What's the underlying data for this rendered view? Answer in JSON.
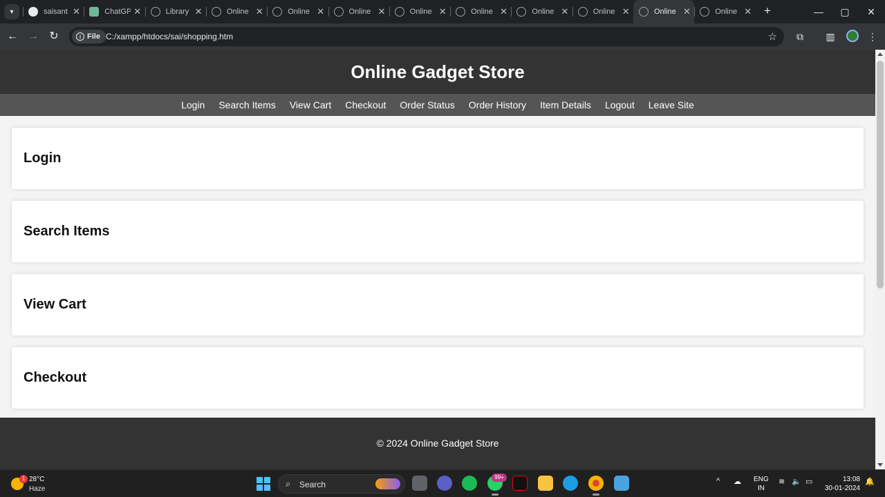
{
  "browser": {
    "tabs": [
      {
        "title": "saisant",
        "favicon": "github-icon",
        "active": false
      },
      {
        "title": "ChatGPT",
        "favicon": "chatgpt-icon",
        "active": false
      },
      {
        "title": "Library",
        "favicon": "globe-icon",
        "active": false
      },
      {
        "title": "Online",
        "favicon": "globe-icon",
        "active": false
      },
      {
        "title": "Online",
        "favicon": "globe-icon",
        "active": false
      },
      {
        "title": "Online",
        "favicon": "globe-icon",
        "active": false
      },
      {
        "title": "Online",
        "favicon": "globe-icon",
        "active": false
      },
      {
        "title": "Online",
        "favicon": "globe-icon",
        "active": false
      },
      {
        "title": "Online",
        "favicon": "globe-icon",
        "active": false
      },
      {
        "title": "Online",
        "favicon": "globe-icon",
        "active": false
      },
      {
        "title": "Online",
        "favicon": "globe-icon",
        "active": true
      },
      {
        "title": "Online",
        "favicon": "globe-icon",
        "active": false
      }
    ],
    "site_info_label": "File",
    "url": "C:/xampp/htdocs/sai/shopping.htm"
  },
  "page": {
    "header_title": "Online Gadget Store",
    "nav": [
      "Login",
      "Search Items",
      "View Cart",
      "Checkout",
      "Order Status",
      "Order History",
      "Item Details",
      "Logout",
      "Leave Site"
    ],
    "sections": [
      "Login",
      "Search Items",
      "View Cart",
      "Checkout"
    ],
    "footer": "© 2024 Online Gadget Store"
  },
  "taskbar": {
    "weather_temp": "28°C",
    "weather_cond": "Haze",
    "weather_badge": "1",
    "search_label": "Search",
    "whatsapp_badge": "99+",
    "lang_line1": "ENG",
    "lang_line2": "IN",
    "time": "13:08",
    "date": "30-01-2024"
  },
  "colors": {
    "header_bg": "#333333",
    "nav_bg": "#555555",
    "page_bg": "#f4f4f4"
  }
}
